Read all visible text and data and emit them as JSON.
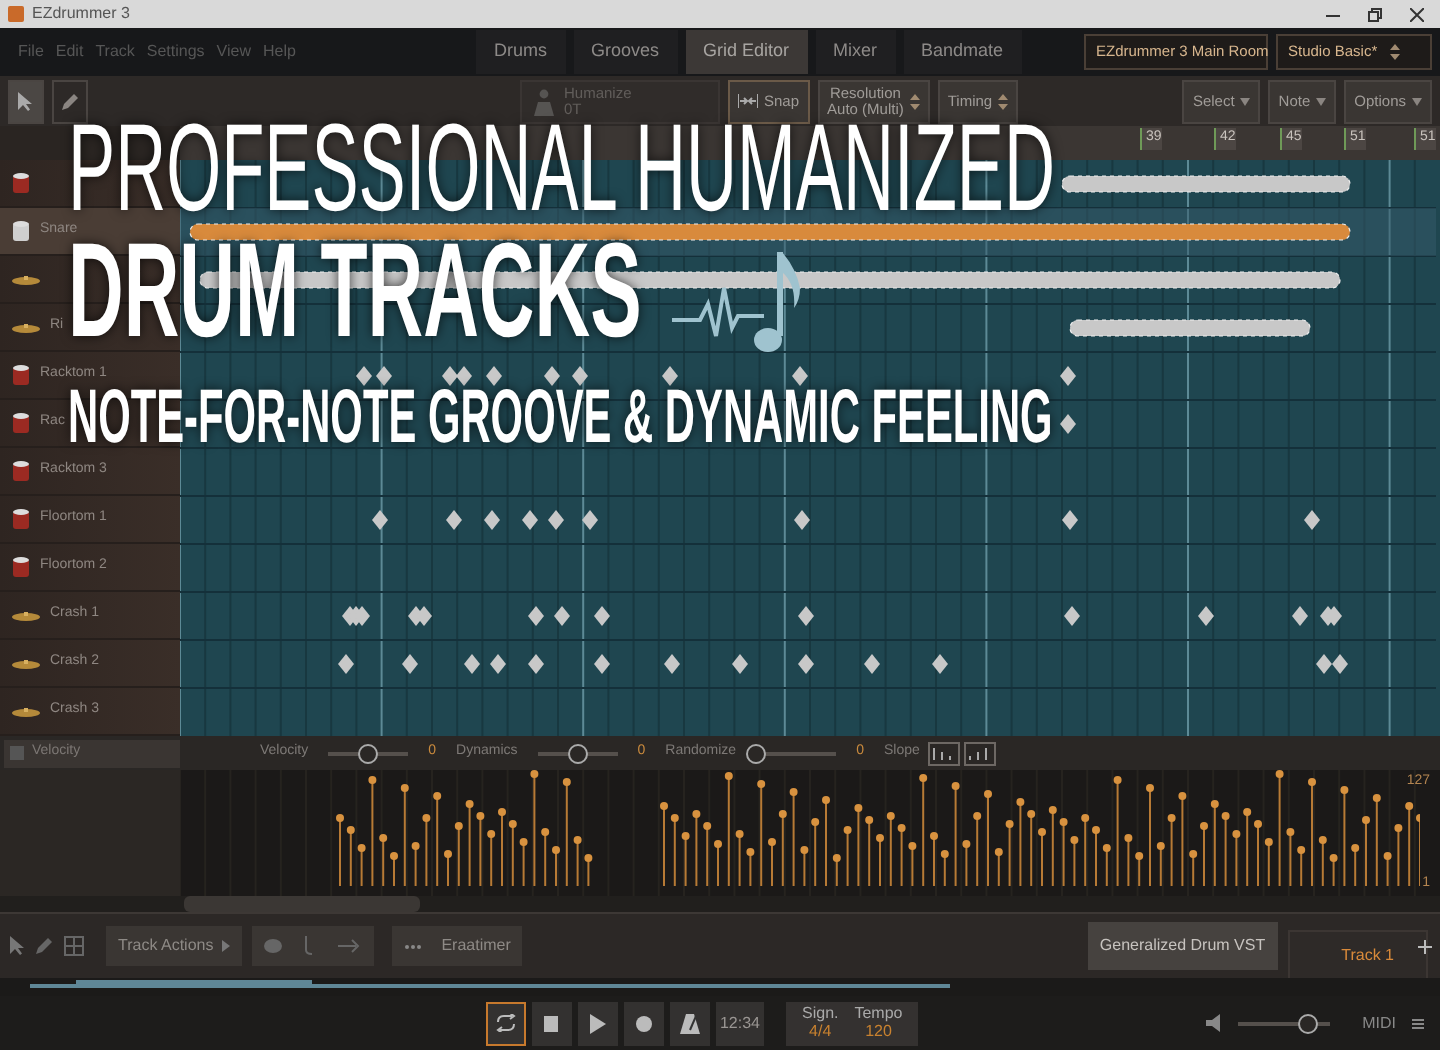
{
  "window": {
    "title": "EZdrummer 3"
  },
  "menu": [
    "File",
    "Edit",
    "Track",
    "Settings",
    "View",
    "Help"
  ],
  "tabs": [
    {
      "label": "Drums",
      "selected": false
    },
    {
      "label": "Grooves",
      "selected": false
    },
    {
      "label": "Grid Editor",
      "selected": true
    },
    {
      "label": "Mixer",
      "selected": false
    },
    {
      "label": "Bandmate",
      "selected": false
    }
  ],
  "selectors": [
    "EZdrummer 3 Main Room",
    "Studio Basic*"
  ],
  "toolbar": {
    "tools": [
      {
        "kind": "pointer",
        "selected": true
      },
      {
        "kind": "pencil",
        "selected": false
      }
    ],
    "humanize": {
      "label": "Humanize",
      "value": "0T",
      "disabled": true
    },
    "snap": {
      "label": "Snap"
    },
    "resolution": {
      "label": "Resolution",
      "value": "Auto (Multi)"
    },
    "timing": {
      "label": "Timing"
    },
    "menus": [
      "Select",
      "Note",
      "Options"
    ]
  },
  "ruler": [
    "39",
    "42",
    "45",
    "51",
    "51"
  ],
  "instruments": [
    {
      "kind": "drum",
      "selected": false
    },
    {
      "kind": "drum",
      "name": "Snare",
      "selected": true
    },
    {
      "kind": "cymbal",
      "selected": false
    },
    {
      "kind": "cymbal",
      "name": "Ri",
      "selected": false
    },
    {
      "kind": "drum",
      "name": "Racktom 1",
      "selected": false
    },
    {
      "kind": "drum",
      "name": "Rac",
      "selected": false
    },
    {
      "kind": "drum",
      "name": "Racktom 3",
      "selected": false
    },
    {
      "kind": "drum",
      "name": "Floortom 1",
      "selected": false
    },
    {
      "kind": "drum",
      "name": "Floortom 2",
      "selected": false
    },
    {
      "kind": "cymbal",
      "name": "Crash 1",
      "selected": false
    },
    {
      "kind": "cymbal",
      "name": "Crash 2",
      "selected": false
    },
    {
      "kind": "cymbal",
      "name": "Crash 3",
      "selected": false
    }
  ],
  "velocity_lane": {
    "parameter": "Velocity",
    "controls": [
      {
        "kind": "slider",
        "label": "Velocity",
        "level": 0.5,
        "reading": "0"
      },
      {
        "kind": "slider",
        "label": "Dynamics",
        "level": 0.5,
        "reading": "0"
      },
      {
        "kind": "slider",
        "label": "Randomize",
        "level": 0,
        "reading": "0"
      },
      {
        "kind": "slope",
        "label": "Slope"
      }
    ],
    "max": "127",
    "min": "1"
  },
  "bottom_toolbar": {
    "track_actions": "Track Actions",
    "button": "Eraatimer",
    "instrument": "Generalized Drum VST",
    "tracks": [
      {
        "label": "Track 1",
        "selected": true
      }
    ]
  },
  "transport": {
    "loop": {
      "on": true
    },
    "time": "12:34",
    "signature": {
      "label": "Sign.",
      "value": "4/4"
    },
    "tempo": {
      "label": "Tempo",
      "value": "120"
    },
    "volume": {
      "level": 0.75
    },
    "midi": "MIDI"
  },
  "headline": {
    "line_1": "PROFESSIONAL HUMANIZED",
    "line_2": "DRUM TRACKS",
    "line_3": "NOTE-FOR-NOTE GROOVE & DYNAMIC FEELING"
  }
}
